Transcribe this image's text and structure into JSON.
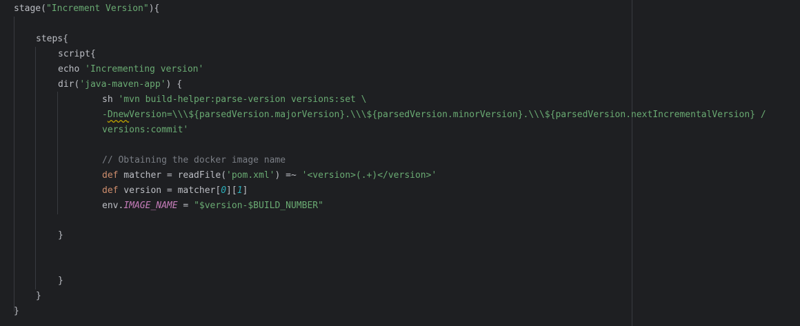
{
  "code": {
    "l1_func": "stage",
    "l1_open": "(",
    "l1_str": "\"Increment Version\"",
    "l1_close": "){",
    "l2": "steps{",
    "l3": "script{",
    "l4_cmd": "echo ",
    "l4_str": "'Incrementing version'",
    "l5_func": "dir(",
    "l5_str": "'java-maven-app'",
    "l5_close": ") {",
    "l6_cmd": "sh ",
    "l6_str": "'mvn build-helper:parse-version versions:set \\",
    "l7_dash": "-",
    "l7_warn": "Dnew",
    "l7_rest": "Version=\\\\\\${parsedVersion.majorVersion}.\\\\\\${parsedVersion.minorVersion}.\\\\\\${parsedVersion.nextIncrementalVersion} /",
    "l8": "versions:commit'",
    "l9_comment": "// Obtaining the docker image name",
    "l10_def": "def",
    "l10_a": " matcher = readFile(",
    "l10_str1": "'pom.xml'",
    "l10_b": ") =~ ",
    "l10_str2": "'<version>(.+)</version>'",
    "l11_def": "def",
    "l11_a": " version = matcher[",
    "l11_n0": "0",
    "l11_b": "][",
    "l11_n1": "1",
    "l11_c": "]",
    "l12_a": "env.",
    "l12_var": "IMAGE_NAME",
    "l12_b": " = ",
    "l12_str": "\"$version-$BUILD_NUMBER\"",
    "close_dir": "}",
    "close_script": "}",
    "close_steps": "}",
    "close_stage": "}"
  },
  "colors": {
    "background": "#1e1f22",
    "default_text": "#bcbec4",
    "keyword": "#cf8e6d",
    "string": "#6aab73",
    "number": "#2aacb8",
    "comment": "#7a7e85",
    "instance_var": "#c77dbb"
  }
}
